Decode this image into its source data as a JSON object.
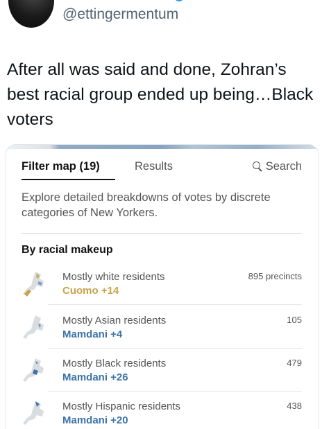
{
  "tweet": {
    "handle": "@ettingermentum",
    "text": "After all was said and done, Zohran’s best racial group ended up being…Black voters"
  },
  "embed": {
    "tabs": [
      {
        "label": "Filter map (19)",
        "active": true
      },
      {
        "label": "Results",
        "active": false
      },
      {
        "label": "Search",
        "active": false,
        "icon": "search-icon"
      }
    ],
    "description": "Explore detailed breakdowns of votes by discrete categories of New Yorkers.",
    "section_title": "By racial makeup",
    "rows": [
      {
        "label": "Mostly white residents",
        "margin": "Cuomo +14",
        "count": "895 precincts",
        "color": "#c9a24a"
      },
      {
        "label": "Mostly Asian residents",
        "margin": "Mamdani +4",
        "count": "105",
        "color": "#3d74a8"
      },
      {
        "label": "Mostly Black residents",
        "margin": "Mamdani +26",
        "count": "479",
        "color": "#3d74a8"
      },
      {
        "label": "Mostly Hispanic residents",
        "margin": "Mamdani +20",
        "count": "438",
        "color": "#3d74a8"
      }
    ]
  }
}
